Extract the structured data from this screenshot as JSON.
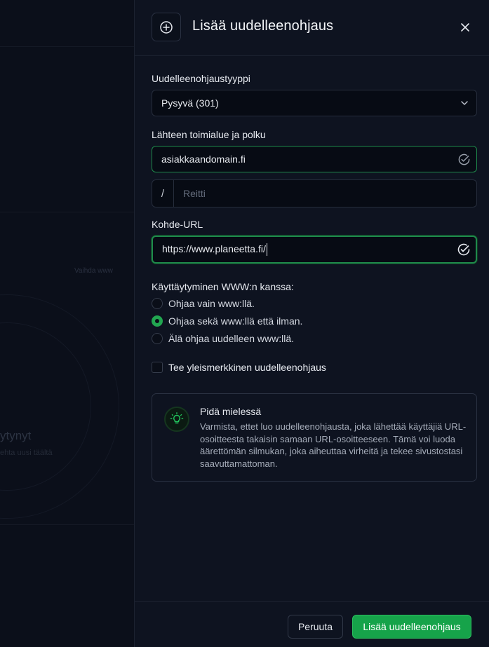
{
  "background": {
    "link_text": "Vaihda www",
    "title_fragment": "ytynyt",
    "subtitle_fragment": "ehta uusi täältä"
  },
  "drawer": {
    "title": "Lisää uudelleenohjaus",
    "header_icon": "plus-circle-icon",
    "close_icon": "close-icon"
  },
  "form": {
    "redirect_type": {
      "label": "Uudelleenohjaustyyppi",
      "selected": "Pysyvä (301)"
    },
    "source": {
      "label": "Lähteen toimialue ja polku",
      "domain_value": "asiakkaandomain.fi",
      "route_prefix": "/",
      "route_placeholder": "Reitti"
    },
    "target": {
      "label": "Kohde-URL",
      "value": "https://www.planeetta.fi/"
    },
    "www_behavior": {
      "label": "Käyttäytyminen WWW:n kanssa:",
      "options": [
        {
          "label": "Ohjaa vain www:llä.",
          "selected": false
        },
        {
          "label": "Ohjaa sekä www:llä että ilman.",
          "selected": true
        },
        {
          "label": "Älä ohjaa uudelleen www:llä.",
          "selected": false
        }
      ]
    },
    "wildcard": {
      "label": "Tee yleismerkkinen uudelleenohjaus",
      "checked": false
    }
  },
  "note": {
    "icon": "lightbulb-icon",
    "title": "Pidä mielessä",
    "body": "Varmista, ettet luo uudelleenohjausta, joka lähettää käyttäjiä URL-osoitteesta takaisin samaan URL-osoitteeseen. Tämä voi luoda äärettömän silmukan, joka aiheuttaa virheitä ja tekee sivustostasi saavuttamattoman."
  },
  "footer": {
    "cancel_label": "Peruuta",
    "submit_label": "Lisää uudelleenohjaus"
  },
  "colors": {
    "accent": "#16a34a",
    "panel": "#0e1320",
    "input_bg": "#070b14",
    "success_border": "#1f8a4c"
  }
}
